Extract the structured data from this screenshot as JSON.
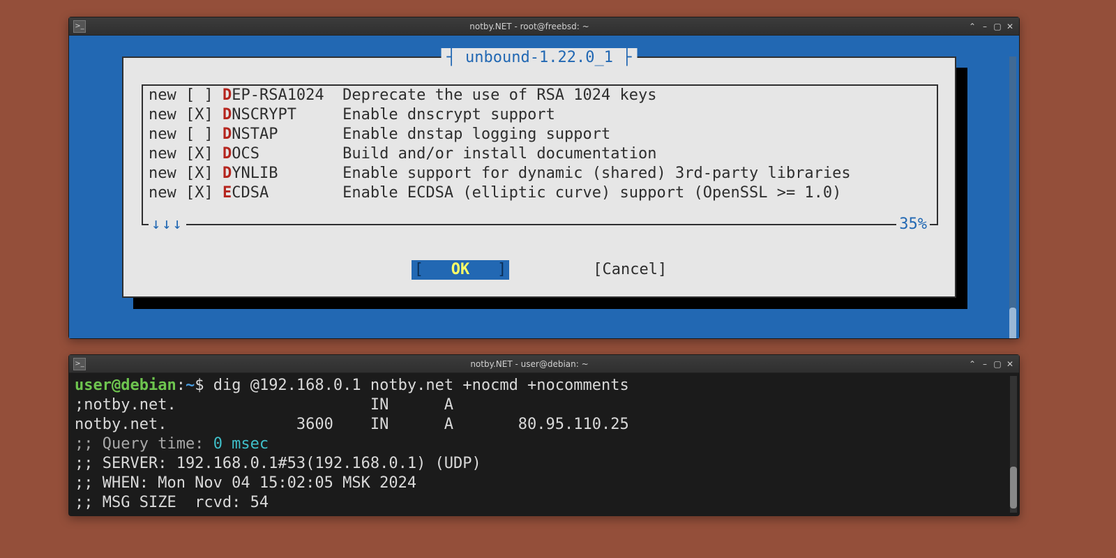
{
  "window1": {
    "title": "notby.NET - root@freebsd: ~",
    "dialog": {
      "name": "unbound-1.22.0_1",
      "scroll_indicator": "↓↓↓",
      "percent": "35%",
      "ok_label": "OK",
      "cancel_label": "Cancel",
      "options": [
        {
          "tag": "new",
          "checked": " ",
          "hot": "D",
          "rest": "EP-RSA1024",
          "desc": "Deprecate the use of RSA 1024 keys"
        },
        {
          "tag": "new",
          "checked": "X",
          "hot": "D",
          "rest": "NSCRYPT",
          "desc": "Enable dnscrypt support"
        },
        {
          "tag": "new",
          "checked": " ",
          "hot": "D",
          "rest": "NSTAP",
          "desc": "Enable dnstap logging support"
        },
        {
          "tag": "new",
          "checked": "X",
          "hot": "D",
          "rest": "OCS",
          "desc": "Build and/or install documentation"
        },
        {
          "tag": "new",
          "checked": "X",
          "hot": "D",
          "rest": "YNLIB",
          "desc": "Enable support for dynamic (shared) 3rd-party libraries"
        },
        {
          "tag": "new",
          "checked": "X",
          "hot": "E",
          "rest": "CDSA",
          "desc": "Enable ECDSA (elliptic curve) support (OpenSSL >= 1.0)"
        }
      ]
    }
  },
  "window2": {
    "title": "notby.NET - user@debian: ~",
    "prompt": {
      "user": "user",
      "host": "debian",
      "path": "~",
      "sigil": "$"
    },
    "command": "dig @192.168.0.1 notby.net +nocmd +nocomments",
    "lines": {
      "q": ";notby.net.                     IN      A",
      "ans": "notby.net.              3600    IN      A       80.95.110.25",
      "qt_label": ";; Query time: ",
      "qt_value": "0 msec",
      "srv": ";; SERVER: 192.168.0.1#53(192.168.0.1) (UDP)",
      "when": ";; WHEN: Mon Nov 04 15:02:05 MSK 2024",
      "size": ";; MSG SIZE  rcvd: 54"
    }
  }
}
